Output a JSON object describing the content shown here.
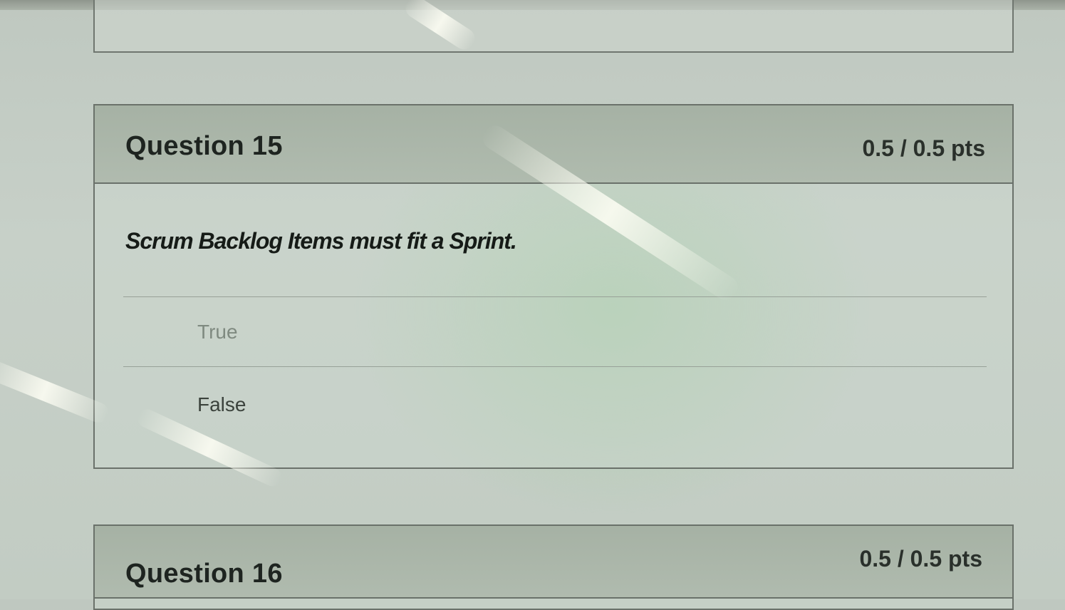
{
  "questions": [
    {
      "title": "Question 15",
      "points": "0.5 / 0.5 pts",
      "prompt": "Scrum Backlog Items must fit a Sprint.",
      "answers": [
        {
          "label": "True"
        },
        {
          "label": "False"
        }
      ]
    },
    {
      "title": "Question 16",
      "points": "0.5 / 0.5 pts"
    }
  ]
}
